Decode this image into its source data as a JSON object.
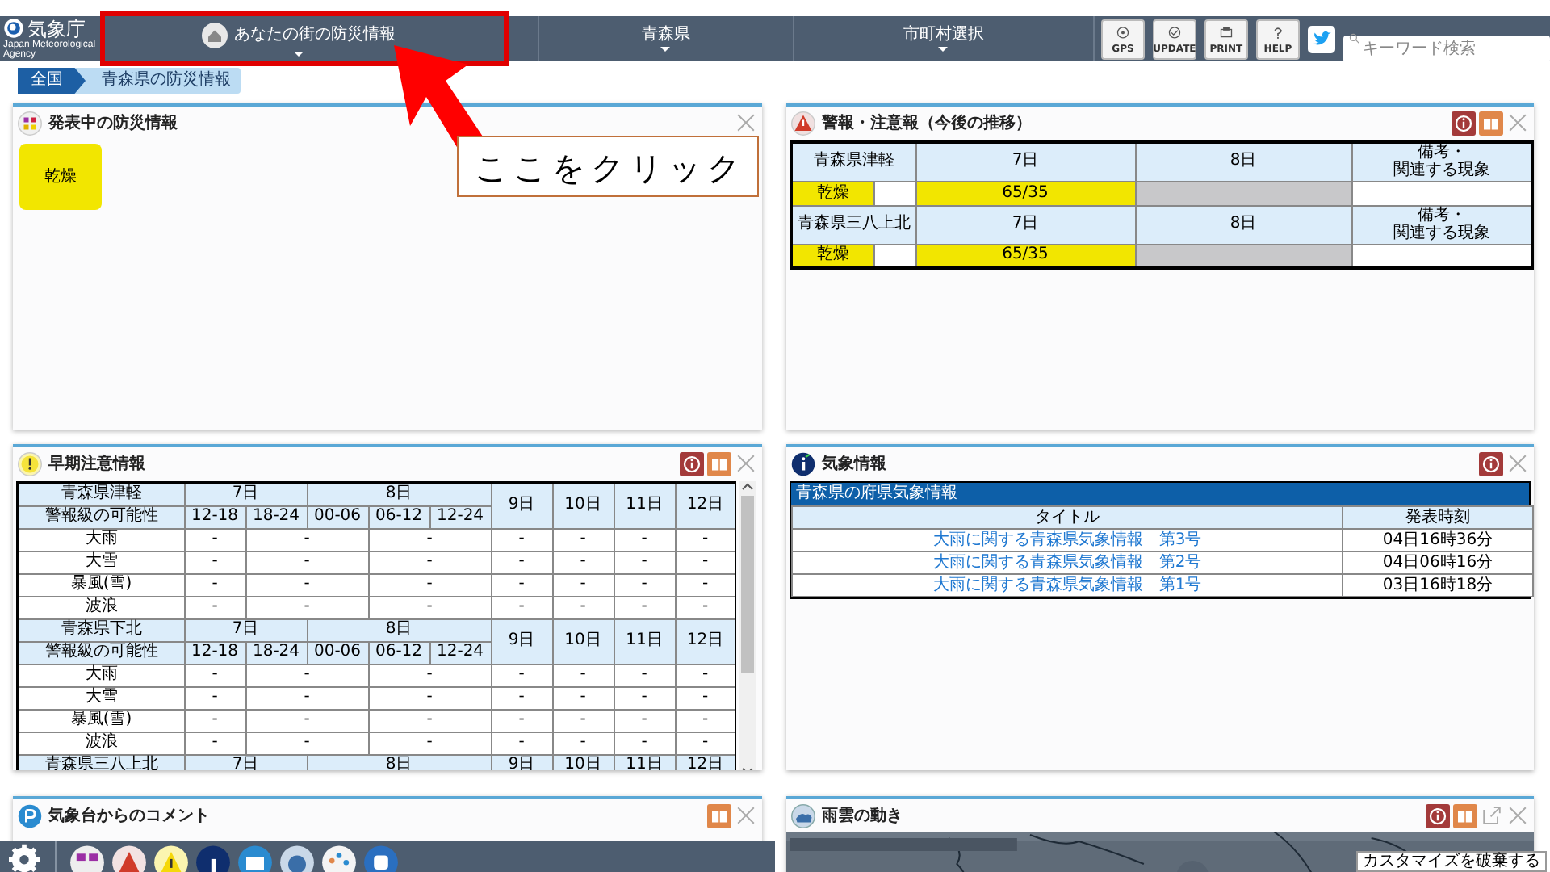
{
  "header": {
    "logo": {
      "name": "気象庁",
      "subtitle": "Japan Meteorological Agency"
    },
    "nav": [
      {
        "label": "あなたの街の防災情報"
      },
      {
        "label": "青森県"
      },
      {
        "label": "市町村選択"
      }
    ],
    "tools": [
      "GPS",
      "UPDATE",
      "PRINT",
      "HELP"
    ],
    "search": {
      "placeholder": "キーワード検索"
    }
  },
  "breadcrumb": [
    "全国",
    "青森県の防災情報"
  ],
  "panels": [
    {
      "kind": "tiles",
      "title": "発表中の防災情報",
      "tiles": [
        {
          "label": "乾燥",
          "color": "#f2e600"
        }
      ]
    },
    {
      "kind": "warnings",
      "title": "警報・注意報（今後の推移）",
      "blocks": [
        {
          "region": "青森県津軽",
          "days": [
            "7日",
            "8日"
          ],
          "remarks": [
            "備考・",
            "関連する現象"
          ],
          "items": [
            {
              "name": "乾燥",
              "values": [
                "65/35"
              ]
            }
          ]
        },
        {
          "region": "青森県三八上北",
          "days": [
            "7日",
            "8日"
          ],
          "remarks": [
            "備考・",
            "関連する現象"
          ],
          "items": [
            {
              "name": "乾燥",
              "values": [
                "65/35"
              ]
            }
          ]
        }
      ]
    },
    {
      "kind": "early",
      "title": "早期注意情報",
      "blocks": [
        {
          "region": "青森県津軽",
          "label": "警報級の可能性",
          "days": [
            {
              "day": "7日",
              "slots": [
                "12-18",
                "18-24"
              ]
            },
            {
              "day": "8日",
              "slots": [
                "00-06",
                "06-12",
                "12-24"
              ]
            }
          ],
          "later_days": [
            "9日",
            "10日",
            "11日",
            "12日"
          ],
          "rows": [
            {
              "name": "大雨",
              "values": [
                "-",
                "-",
                "-",
                "-",
                "-",
                "-",
                "-"
              ]
            },
            {
              "name": "大雪",
              "values": [
                "-",
                "-",
                "-",
                "-",
                "-",
                "-",
                "-"
              ]
            },
            {
              "name": "暴風(雪)",
              "values": [
                "-",
                "-",
                "-",
                "-",
                "-",
                "-",
                "-"
              ]
            },
            {
              "name": "波浪",
              "values": [
                "-",
                "-",
                "-",
                "-",
                "-",
                "-",
                "-"
              ]
            }
          ]
        },
        {
          "region": "青森県下北",
          "label": "警報級の可能性",
          "days": [
            {
              "day": "7日",
              "slots": [
                "12-18",
                "18-24"
              ]
            },
            {
              "day": "8日",
              "slots": [
                "00-06",
                "06-12",
                "12-24"
              ]
            }
          ],
          "later_days": [
            "9日",
            "10日",
            "11日",
            "12日"
          ],
          "rows": [
            {
              "name": "大雨",
              "values": [
                "-",
                "-",
                "-",
                "-",
                "-",
                "-",
                "-"
              ]
            },
            {
              "name": "大雪",
              "values": [
                "-",
                "-",
                "-",
                "-",
                "-",
                "-",
                "-"
              ]
            },
            {
              "name": "暴風(雪)",
              "values": [
                "-",
                "-",
                "-",
                "-",
                "-",
                "-",
                "-"
              ]
            },
            {
              "name": "波浪",
              "values": [
                "-",
                "-",
                "-",
                "-",
                "-",
                "-",
                "-"
              ]
            }
          ]
        },
        {
          "region": "青森県三八上北",
          "days": [
            {
              "day": "7日"
            },
            {
              "day": "8日"
            }
          ],
          "later_days": [
            "9日",
            "10日",
            "11日",
            "12日"
          ]
        }
      ]
    },
    {
      "kind": "bulletins",
      "title": "気象情報",
      "section": "青森県の府県気象情報",
      "columns": [
        "タイトル",
        "発表時刻"
      ],
      "rows": [
        {
          "title": "大雨に関する青森県気象情報　第3号",
          "time": "04日16時36分"
        },
        {
          "title": "大雨に関する青森県気象情報　第2号",
          "time": "04日06時16分"
        },
        {
          "title": "大雨に関する青森県気象情報　第1号",
          "time": "03日16時18分"
        }
      ]
    },
    {
      "kind": "comment",
      "title": "気象台からのコメント"
    },
    {
      "kind": "map",
      "title": "雨雲の動き"
    }
  ],
  "tooltip": "カスタマイズを破棄する",
  "annotation": {
    "callout": "ここをクリック"
  }
}
